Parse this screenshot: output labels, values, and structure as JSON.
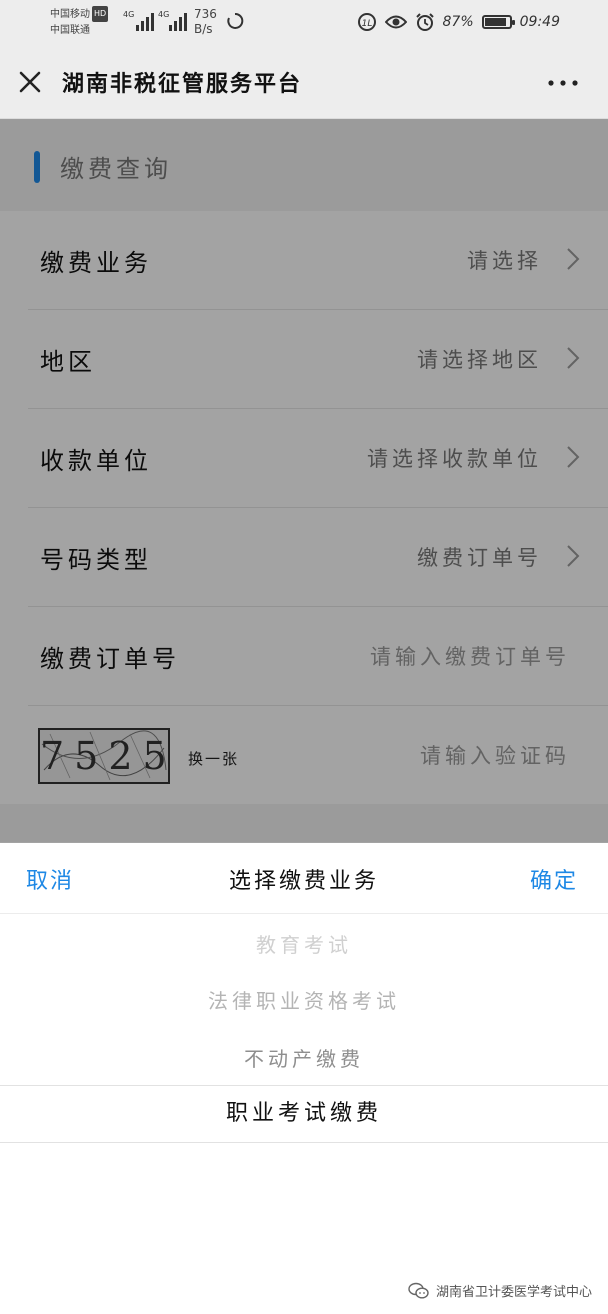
{
  "status_bar": {
    "carrier_1": "中国移动",
    "carrier_1_badge": "HD",
    "carrier_2": "中国联通",
    "network_1": "4G",
    "network_2": "4G",
    "speed_value": "736",
    "speed_unit": "B/s",
    "battery_percent": "87%",
    "battery_level": 0.87,
    "time": "09:49"
  },
  "header": {
    "title": "湖南非税征管服务平台"
  },
  "section": {
    "title": "缴费查询"
  },
  "form": {
    "rows": [
      {
        "label": "缴费业务",
        "value": "请选择"
      },
      {
        "label": "地区",
        "value": "请选择地区"
      },
      {
        "label": "收款单位",
        "value": "请选择收款单位"
      },
      {
        "label": "号码类型",
        "value": "缴费订单号"
      },
      {
        "label": "缴费订单号",
        "placeholder": "请输入缴费订单号"
      }
    ],
    "captcha": {
      "code": "7525",
      "refresh_label": "换一张",
      "placeholder": "请输入验证码"
    }
  },
  "picker": {
    "cancel_label": "取消",
    "title": "选择缴费业务",
    "confirm_label": "确定",
    "options": [
      "教育考试",
      "法律职业资格考试",
      "不动产缴费",
      "职业考试缴费"
    ],
    "selected_index": 3
  },
  "watermark": {
    "text": "湖南省卫计委医学考试中心"
  },
  "colors": {
    "accent": "#1e88e5",
    "overlay": "rgba(0,0,0,0.35)"
  }
}
